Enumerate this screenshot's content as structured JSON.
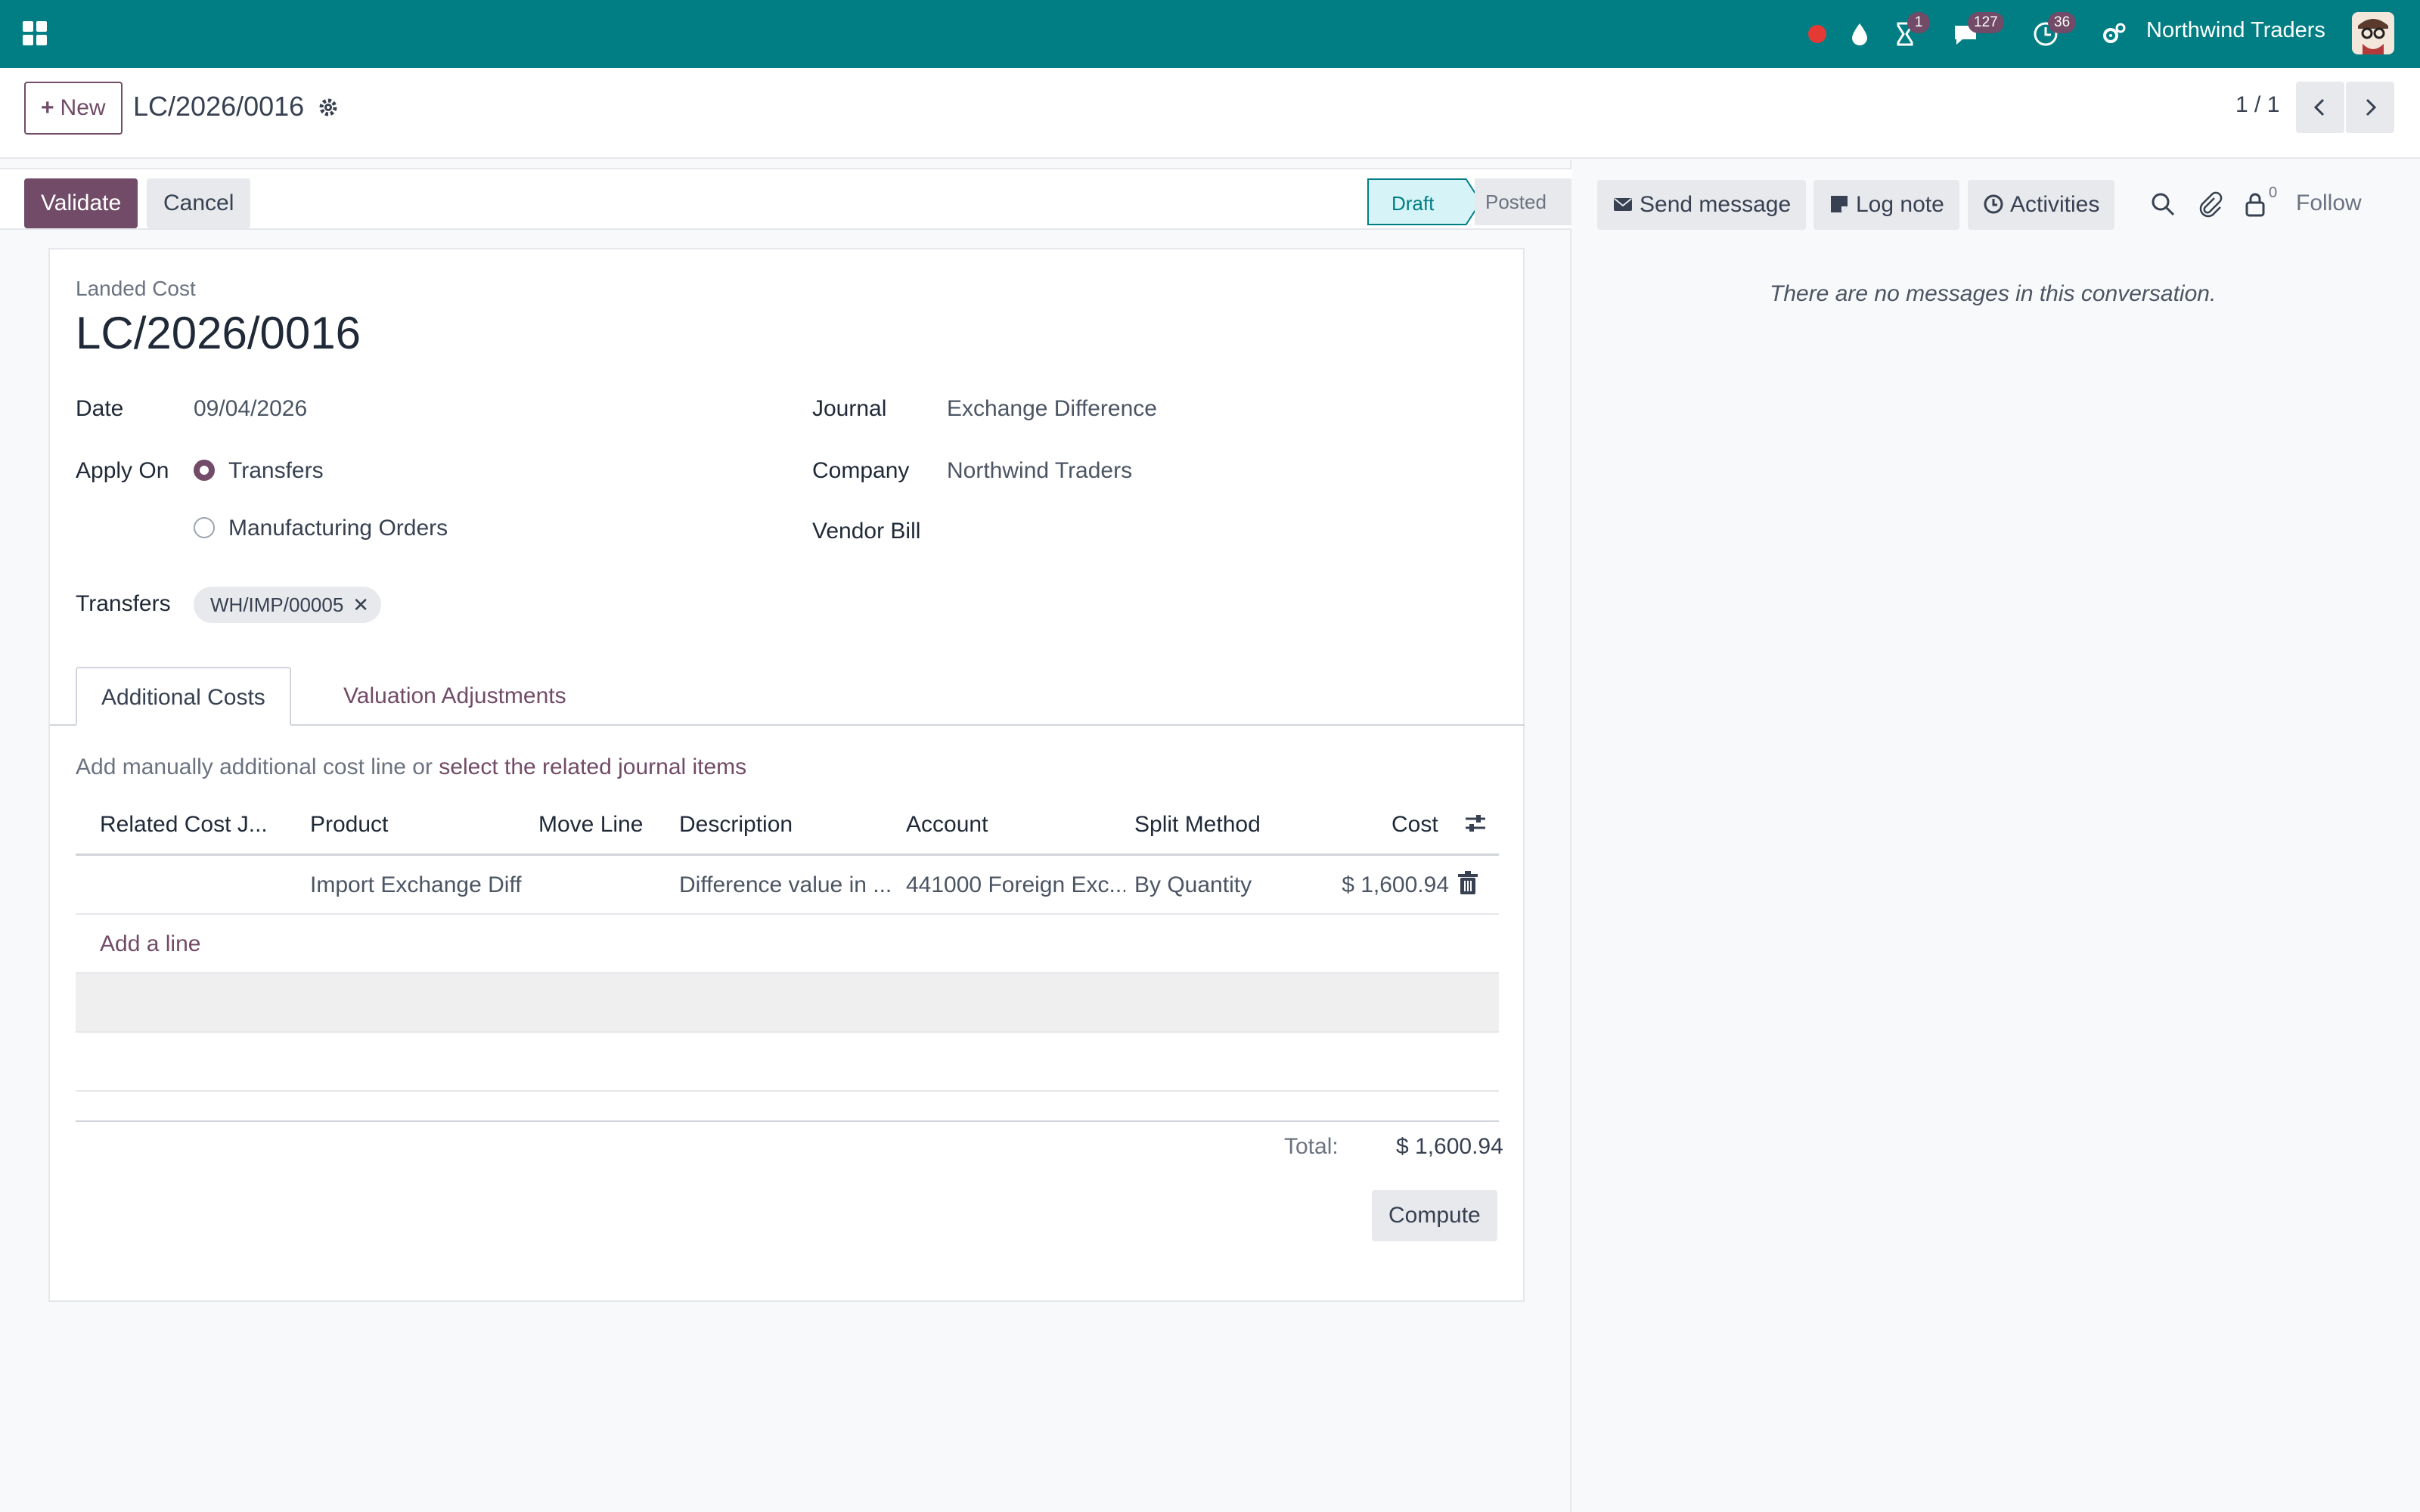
{
  "navbar": {
    "company": "Northwind Traders",
    "badges": {
      "activities": "1",
      "messages": "127",
      "timer": "36"
    },
    "colors": {
      "bar": "#017e84",
      "badge": "#714b67",
      "recording": "#e53935"
    }
  },
  "control_panel": {
    "new_label": "New",
    "breadcrumb": "LC/2026/0016",
    "pager": "1 / 1"
  },
  "statusbar": {
    "validate_label": "Validate",
    "cancel_label": "Cancel",
    "stages": [
      "Draft",
      "Posted"
    ],
    "current_stage": "Draft"
  },
  "form": {
    "small_title": "Landed Cost",
    "title": "LC/2026/0016",
    "fields": {
      "date_label": "Date",
      "date_value": "09/04/2026",
      "apply_on_label": "Apply On",
      "apply_on_options": [
        "Transfers",
        "Manufacturing Orders"
      ],
      "apply_on_selected": "Transfers",
      "journal_label": "Journal",
      "journal_value": "Exchange Difference",
      "company_label": "Company",
      "company_value": "Northwind Traders",
      "vendor_bill_label": "Vendor Bill",
      "transfers_label": "Transfers",
      "transfer_tag": "WH/IMP/00005"
    },
    "tabs": [
      "Additional Costs",
      "Valuation Adjustments"
    ],
    "active_tab": "Additional Costs",
    "hint_text": "Add manually additional cost line or",
    "hint_link": "select the related journal items",
    "table": {
      "columns": [
        "Related Cost J...",
        "Product",
        "Move Line",
        "Description",
        "Account",
        "Split Method",
        "Cost"
      ],
      "rows": [
        {
          "related": "",
          "product": "Import Exchange Diff",
          "move_line": "",
          "description": "Difference value in ...",
          "account": "441000 Foreign Exc...",
          "split_method": "By Quantity",
          "cost": "$ 1,600.94"
        }
      ],
      "add_line_label": "Add a line"
    },
    "total_label": "Total:",
    "total_value": "$ 1,600.94",
    "compute_label": "Compute"
  },
  "chatter": {
    "send_message": "Send message",
    "log_note": "Log note",
    "activities": "Activities",
    "follower_count": "0",
    "follow": "Follow",
    "empty_text": "There are no messages in this conversation."
  }
}
